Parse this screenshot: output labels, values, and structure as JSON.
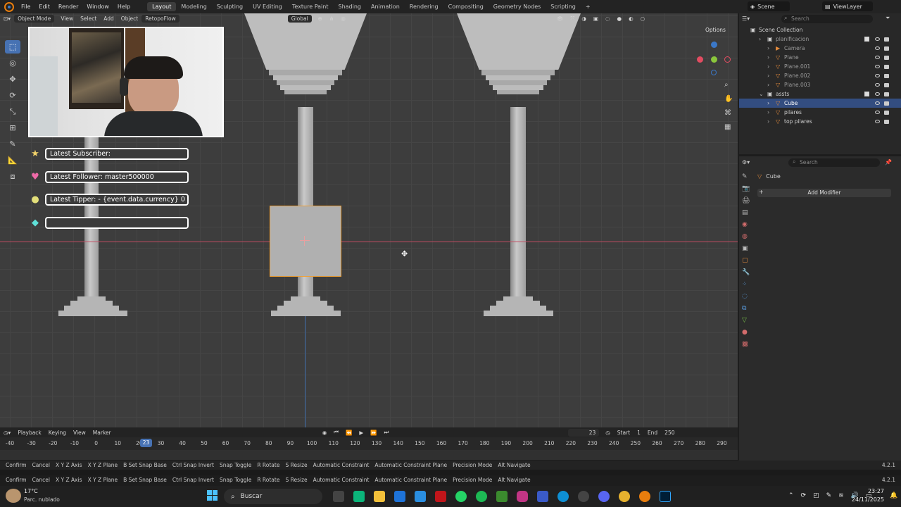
{
  "topbar": {
    "menus": [
      "File",
      "Edit",
      "Render",
      "Window",
      "Help"
    ],
    "workspaces": [
      "Layout",
      "Modeling",
      "Sculpting",
      "UV Editing",
      "Texture Paint",
      "Shading",
      "Animation",
      "Rendering",
      "Compositing",
      "Geometry Nodes",
      "Scripting"
    ],
    "active_workspace": "Layout",
    "add_tab": "+",
    "scene": "Scene",
    "view_layer": "ViewLayer"
  },
  "viewport": {
    "mode": "Object Mode",
    "menus": [
      "View",
      "Select",
      "Add",
      "Object"
    ],
    "addon": "RetopoFlow",
    "orientation": "Global",
    "options": "Options"
  },
  "stream_overlay": {
    "subscriber": "Latest Subscriber:",
    "follower": "Latest Follower: master500000",
    "tipper": "Latest Tipper: - {event.data.currency} 0",
    "empty": ""
  },
  "outliner": {
    "search_placeholder": "Search",
    "root": "Scene Collection",
    "items": [
      {
        "label": "planificacion",
        "indent": 1
      },
      {
        "label": "Camera",
        "indent": 2
      },
      {
        "label": "Plane",
        "indent": 2
      },
      {
        "label": "Plane.001",
        "indent": 2
      },
      {
        "label": "Plane.002",
        "indent": 2
      },
      {
        "label": "Plane.003",
        "indent": 2
      },
      {
        "label": "assts",
        "indent": 1
      },
      {
        "label": "Cube",
        "indent": 2
      },
      {
        "label": "pilares",
        "indent": 2
      },
      {
        "label": "top pilares",
        "indent": 2
      }
    ],
    "selected": "Cube"
  },
  "properties": {
    "search_placeholder": "Search",
    "object_name": "Cube",
    "add_modifier": "Add Modifier"
  },
  "timeline": {
    "menus": [
      "Playback",
      "Keying",
      "View",
      "Marker"
    ],
    "current_frame": "23",
    "start_label": "Start",
    "start": "1",
    "end_label": "End",
    "end": "250",
    "ruler_playhead": "23",
    "ticks": [
      "-40",
      "-30",
      "-20",
      "-10",
      "0",
      "10",
      "20",
      "30",
      "40",
      "50",
      "60",
      "70",
      "80",
      "90",
      "100",
      "110",
      "120",
      "130",
      "140",
      "150",
      "160",
      "170",
      "180",
      "190",
      "200",
      "210",
      "220",
      "230",
      "240",
      "250",
      "260",
      "270",
      "280",
      "290"
    ]
  },
  "statusbar": {
    "hints": [
      "Confirm",
      "Cancel",
      "X Y Z Axis",
      "X Y Z Plane",
      "B Set Snap Base",
      "Ctrl Snap Invert",
      "Snap Toggle",
      "R Rotate",
      "S Resize",
      "Automatic Constraint",
      "Automatic Constraint Plane",
      "Precision Mode",
      "Alt Navigate"
    ],
    "version": "4.2.1"
  },
  "taskbar": {
    "weather_temp": "17°C",
    "weather_desc": "Parc. nublado",
    "search_label": "Buscar",
    "time": "23:27",
    "date": "24/11/2025"
  }
}
